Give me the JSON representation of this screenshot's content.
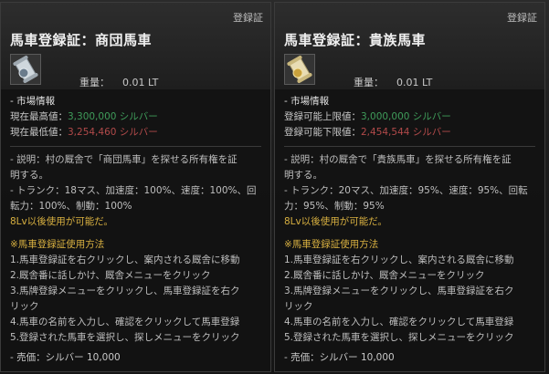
{
  "left": {
    "corner_label": "登録証",
    "title": "馬車登録証：商団馬車",
    "weight_label": "重量：",
    "weight_value": "0.01 LT",
    "market_header": "- 市場情報",
    "price_rows": [
      {
        "label": "現在最高値：",
        "value": "3,300,000 シルバー",
        "color": "green"
      },
      {
        "label": "現在最低値：",
        "value": "3,254,460 シルバー",
        "color": "red"
      }
    ],
    "desc_lines": [
      "- 説明：村の厩舎で「商団馬車」を探せる所有権を証",
      "明する。",
      "- トランク：18マス、加速度：100%、速度：100%、回",
      "転力：100%、制動：100%"
    ],
    "level_line": "8Lv以後使用が可能だ。",
    "usage_header": "※馬車登録証使用方法",
    "usage_lines": [
      "1.馬車登録証を右クリックし、案内される厩舎に移動",
      "2.厩舎番に話しかけ、厩舎メニューをクリック",
      "3.馬牌登録メニューをクリックし、馬車登録証を右ク",
      "リック",
      "4.馬車の名前を入力し、確認をクリックして馬車登録",
      "5.登録された馬車を選択し、探しメニューをクリック"
    ],
    "sell_label": "- 売価：",
    "sell_value": "シルバー 10,000"
  },
  "right": {
    "corner_label": "登録証",
    "title": "馬車登録証：貴族馬車",
    "weight_label": "重量：",
    "weight_value": "0.01 LT",
    "market_header": "- 市場情報",
    "price_rows": [
      {
        "label": "登録可能上限値：",
        "value": "3,000,000 シルバー",
        "color": "green"
      },
      {
        "label": "登録可能下限値：",
        "value": "2,454,544 シルバー",
        "color": "red"
      }
    ],
    "desc_lines": [
      "- 説明：村の厩舎で「貴族馬車」を探せる所有権を証",
      "明する。",
      "- トランク：20マス、加速度：95%、速度：95%、回転",
      "力：95%、制動：95%"
    ],
    "level_line": "8Lv以後使用が可能だ。",
    "usage_header": "※馬車登録証使用方法",
    "usage_lines": [
      "1.馬車登録証を右クリックし、案内される厩舎に移動",
      "2.厩舎番に話しかけ、厩舎メニューをクリック",
      "3.馬牌登録メニューをクリックし、馬車登録証を右ク",
      "リック",
      "4.馬車の名前を入力し、確認をクリックして馬車登録",
      "5.登録された馬車を選択し、探しメニューをクリック"
    ],
    "sell_label": "- 売価：",
    "sell_value": "シルバー 10,000"
  },
  "colors": {
    "green": "#3f9c5a",
    "red": "#b24a4a",
    "gold": "#d8b040"
  },
  "icons": {
    "left": "scroll-certificate-icon",
    "right": "scroll-certificate-gold-icon"
  }
}
